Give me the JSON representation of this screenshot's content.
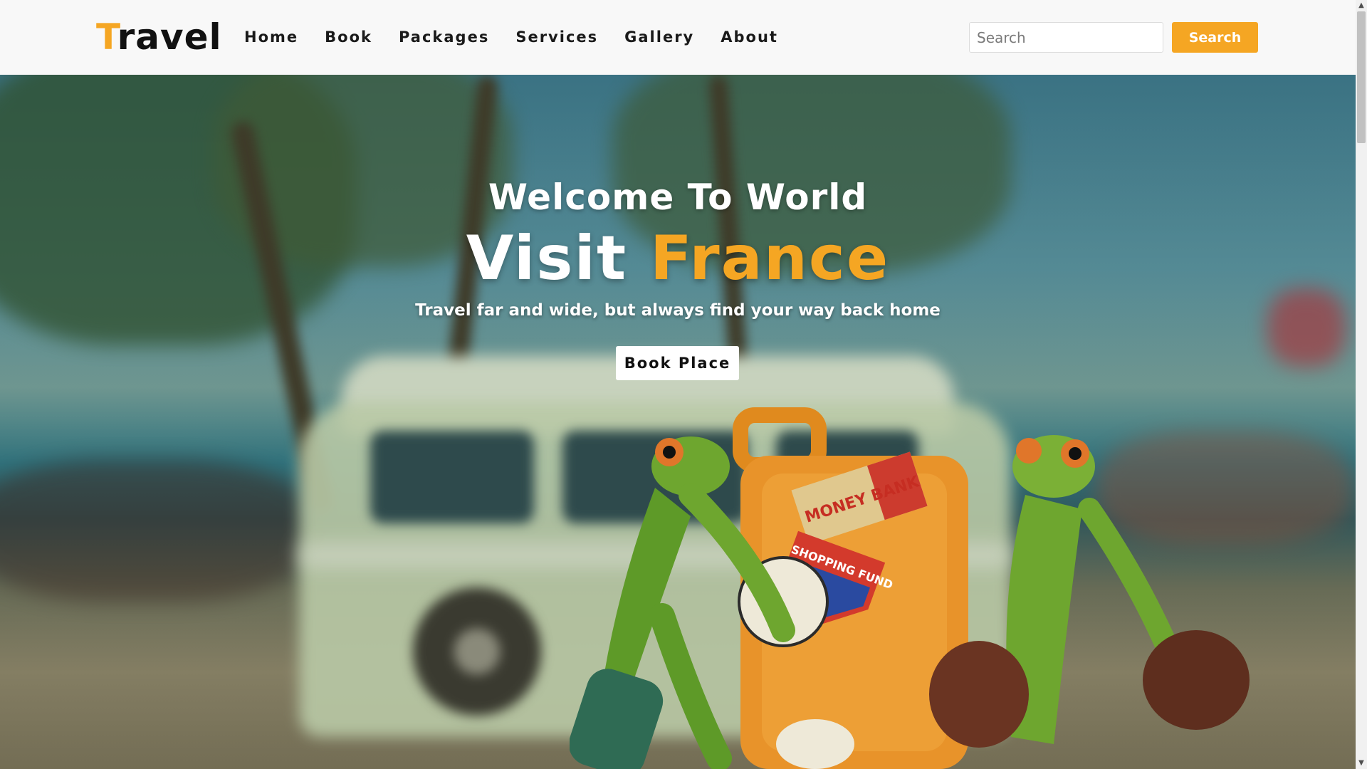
{
  "brand": {
    "logo_first_letter": "T",
    "logo_rest": "ravel",
    "accent_color": "#f5a623"
  },
  "nav": {
    "items": [
      {
        "label": "Home"
      },
      {
        "label": "Book"
      },
      {
        "label": "Packages"
      },
      {
        "label": "Services"
      },
      {
        "label": "Gallery"
      },
      {
        "label": "About"
      }
    ]
  },
  "search": {
    "placeholder": "Search",
    "button_label": "Search"
  },
  "hero": {
    "subtitle": "Welcome To World",
    "title_part1": "Visit",
    "title_part2": "France",
    "tagline": "Travel far and wide, but always find your way back home",
    "cta_label": "Book Place",
    "image_stickers": [
      "MONEY BANK",
      "SHOPPING FUND"
    ]
  },
  "scrollbar": {
    "up_icon": "scroll-up-arrow-icon",
    "down_icon": "scroll-down-arrow-icon"
  }
}
